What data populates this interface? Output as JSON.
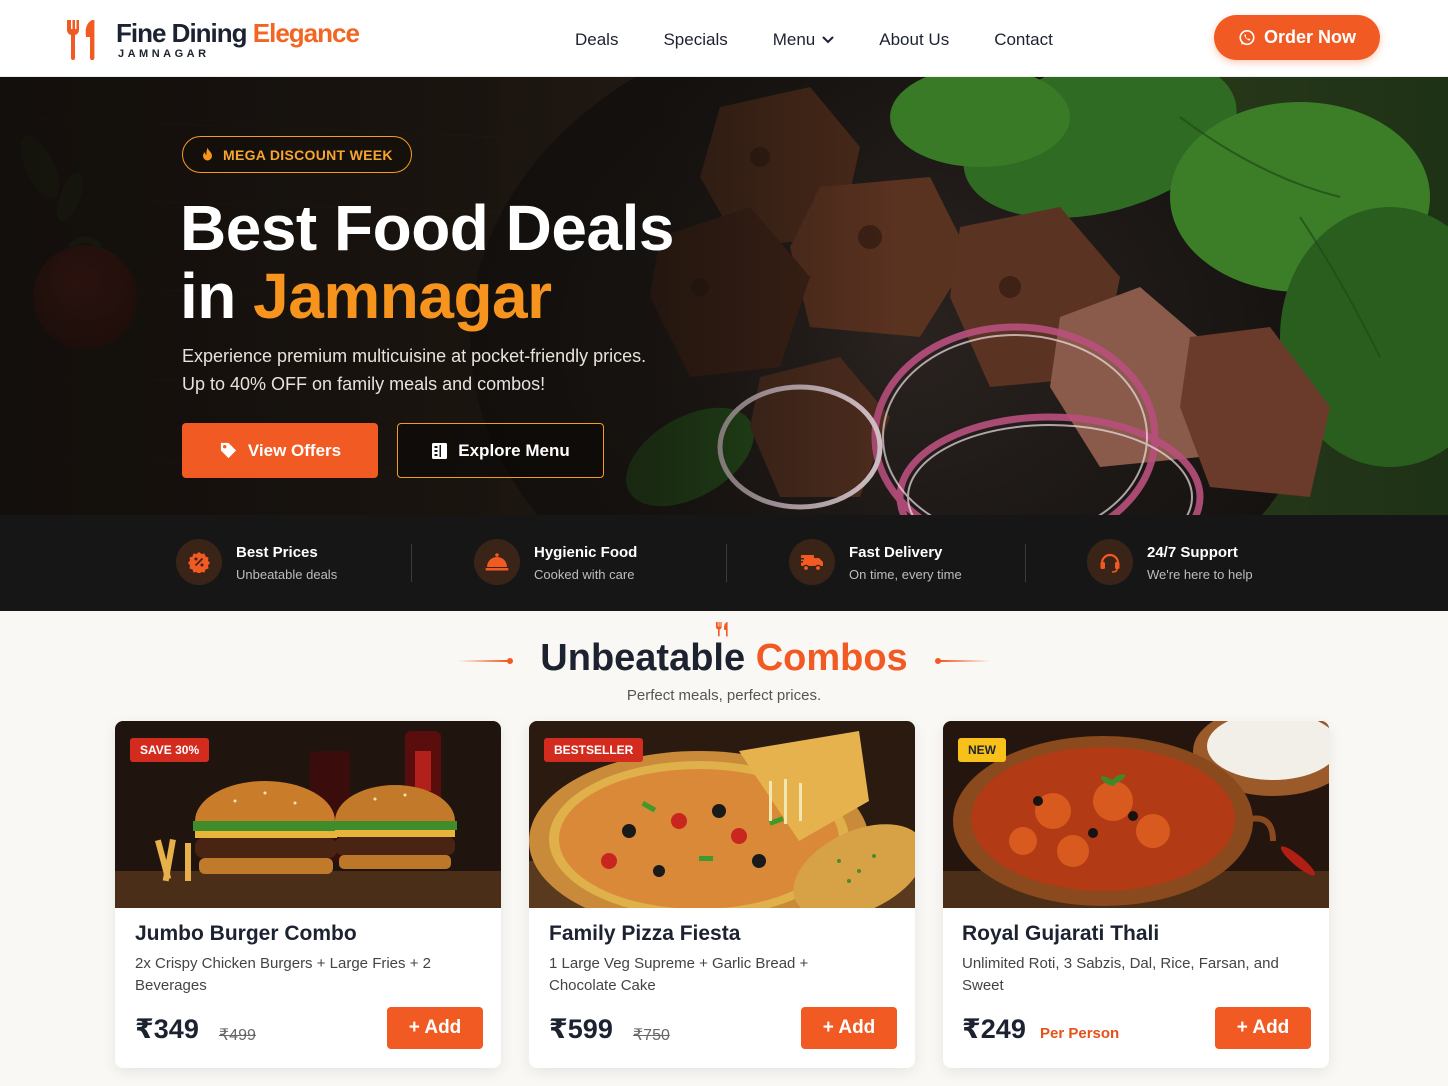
{
  "brand": {
    "name_part1": "Fine Dining ",
    "name_part2": "Elegance",
    "location": "JAMNAGAR",
    "accent_color": "#f15a22"
  },
  "nav": {
    "items": [
      "Deals",
      "Specials",
      "Menu",
      "About Us",
      "Contact"
    ],
    "order_label": "Order Now"
  },
  "hero": {
    "badge": "MEGA DISCOUNT WEEK",
    "title_line1": "Best Food Deals",
    "title_line2_prefix": "in ",
    "title_line2_accent": "Jamnagar",
    "line1": "Experience premium multicuisine at pocket-friendly prices.",
    "line2": "Up to 40% OFF on family meals and combos!",
    "primary_btn": "View Offers",
    "secondary_btn": "Explore Menu"
  },
  "features": [
    {
      "title": "Best Prices",
      "sub": "Unbeatable deals",
      "icon": "discount-badge-icon"
    },
    {
      "title": "Hygienic Food",
      "sub": "Cooked with care",
      "icon": "cloche-icon"
    },
    {
      "title": "Fast Delivery",
      "sub": "On time, every time",
      "icon": "delivery-truck-icon"
    },
    {
      "title": "24/7 Support",
      "sub": "We're here to help",
      "icon": "headset-icon"
    }
  ],
  "section": {
    "title_part1": "Unbeatable ",
    "title_part2": "Combos",
    "subtitle": "Perfect meals, perfect prices."
  },
  "cards": [
    {
      "tag": "SAVE 30%",
      "name": "Jumbo Burger Combo",
      "desc": "2x Crispy Chicken Burgers + Large Fries + 2 Beverages",
      "price": "₹349",
      "old_price": "₹499",
      "add": "+ Add"
    },
    {
      "tag": "BESTSELLER",
      "name": "Family Pizza Fiesta",
      "desc": "1 Large Veg Supreme + Garlic Bread + Chocolate Cake",
      "price": "₹599",
      "old_price": "₹750",
      "add": "+ Add"
    },
    {
      "tag": "NEW",
      "name": "Royal Gujarati Thali",
      "desc": "Unlimited Roti, 3 Sabzis, Dal, Rice, Farsan, and Sweet",
      "price": "₹249",
      "per": "Per Person",
      "add": "+ Add"
    }
  ]
}
